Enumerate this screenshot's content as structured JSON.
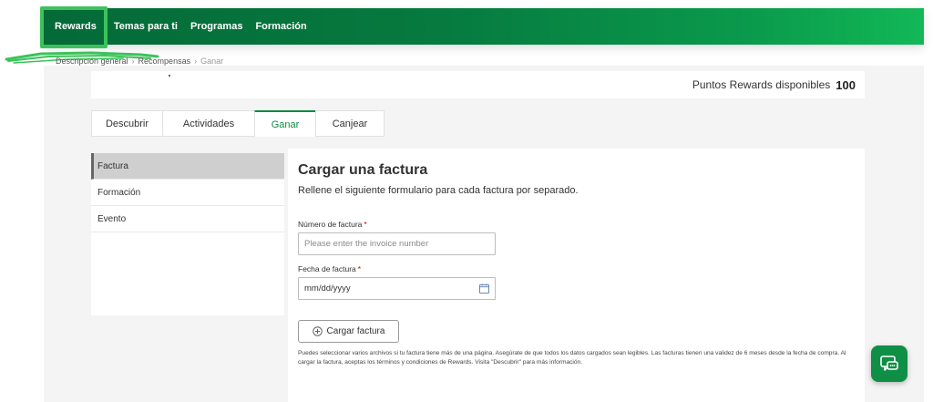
{
  "nav": {
    "items": [
      {
        "label": "Rewards"
      },
      {
        "label": "Temas para ti"
      },
      {
        "label": "Programas"
      },
      {
        "label": "Formación"
      }
    ]
  },
  "breadcrumb": {
    "items": [
      "Descripción general",
      "Recompensas",
      "Ganar"
    ]
  },
  "points": {
    "label": "Puntos Rewards disponibles",
    "value": "100"
  },
  "tabs": [
    {
      "label": "Descubrir"
    },
    {
      "label": "Actividades"
    },
    {
      "label": "Ganar",
      "active": true
    },
    {
      "label": "Canjear"
    }
  ],
  "side_menu": {
    "items": [
      {
        "label": "Factura",
        "active": true
      },
      {
        "label": "Formación"
      },
      {
        "label": "Evento"
      }
    ]
  },
  "form": {
    "title": "Cargar una factura",
    "subtitle": "Rellene el siguiente formulario para cada factura por separado.",
    "invoice_number": {
      "label": "Número de factura",
      "required_mark": "*",
      "placeholder": "Please enter the invoice number"
    },
    "invoice_date": {
      "label": "Fecha de factura",
      "required_mark": "*",
      "value": "mm/dd/yyyy"
    },
    "upload_button": "Cargar factura",
    "help_text": "Puedes seleccionar varios archivos si tu factura tiene más de una página. Asegúrate de que todos los datos cargados sean legibles. Las facturas tienen una validez de 6 meses desde la fecha de compra. Al cargar la factura, aceptas los términos y condiciones de Rewards. Visita \"Descubrir\" para más información."
  },
  "colors": {
    "brand_green": "#0a8a43",
    "highlight_green": "#3cc25a",
    "chat_green": "#0f8f46"
  },
  "icons": {
    "calendar": "calendar-icon",
    "plus": "plus-circle-icon",
    "chat": "chat-icon"
  }
}
